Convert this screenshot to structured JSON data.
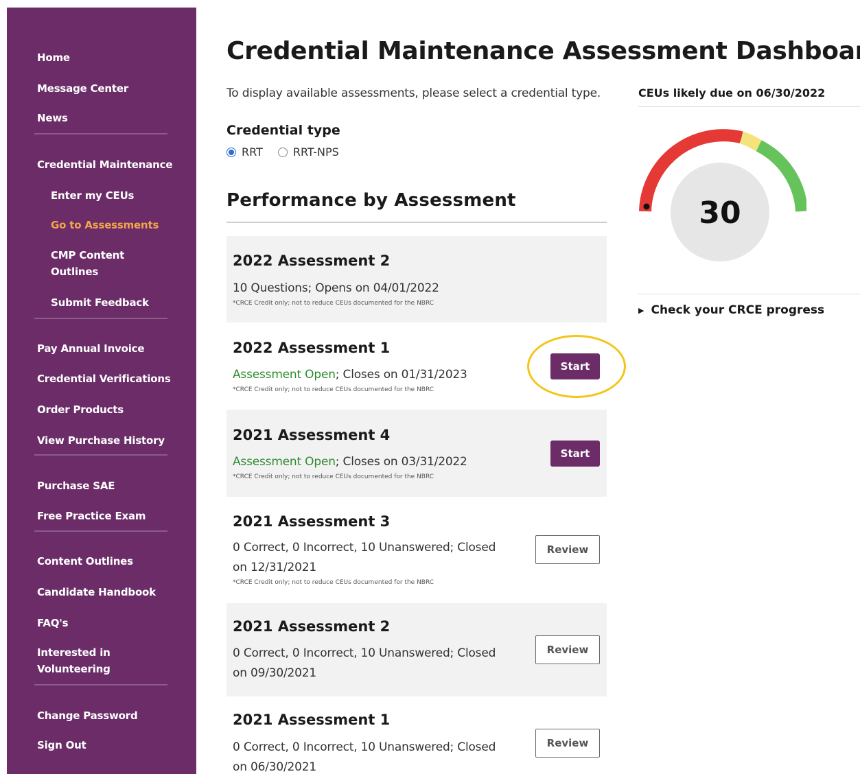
{
  "sidebar": {
    "items": [
      {
        "label": "Home"
      },
      {
        "label": "Message Center"
      },
      {
        "label": "News"
      },
      {
        "label": "Credential Maintenance"
      },
      {
        "label": "Enter my CEUs"
      },
      {
        "label": "Go to Assessments"
      },
      {
        "label": "CMP Content"
      },
      {
        "label": "Outlines"
      },
      {
        "label": "Submit Feedback"
      },
      {
        "label": "Pay Annual Invoice"
      },
      {
        "label": "Credential Verifications"
      },
      {
        "label": "Order Products"
      },
      {
        "label": "View Purchase History"
      },
      {
        "label": "Purchase SAE"
      },
      {
        "label": "Free Practice Exam"
      },
      {
        "label": "Content Outlines"
      },
      {
        "label": "Candidate Handbook"
      },
      {
        "label": "FAQ's"
      },
      {
        "label": "Interested in"
      },
      {
        "label": "Volunteering"
      },
      {
        "label": "Change Password"
      },
      {
        "label": "Sign Out"
      }
    ],
    "active_item": "Go to Assessments",
    "colors": {
      "background": "#6b2c68",
      "active": "#f2a54a"
    }
  },
  "main": {
    "title": "Credential Maintenance Assessment Dashboard",
    "instruction": "To display available assessments, please select a credential type.",
    "credential_type": {
      "label": "Credential type",
      "options": [
        "RRT",
        "RRT-NPS"
      ],
      "selected": "RRT"
    },
    "performance_heading": "Performance by Assessment",
    "assessments": [
      {
        "title": "2022 Assessment 2",
        "line1": "10 Questions; Opens on 04/01/2022",
        "note": "*CRCE Credit only; not to reduce CEUs documented for the NBRC"
      },
      {
        "title": "2022 Assessment 1",
        "status": "Assessment Open",
        "line1_rest": "; Closes on 01/31/2023",
        "note": "*CRCE Credit only; not to reduce CEUs documented for the NBRC",
        "button": "Start"
      },
      {
        "title": "2021 Assessment 4",
        "status": "Assessment Open",
        "line1_rest": "; Closes on 03/31/2022",
        "note": "*CRCE Credit only; not to reduce CEUs documented for the NBRC",
        "button": "Start"
      },
      {
        "title": "2021 Assessment 3",
        "line1": "0 Correct, 0 Incorrect, 10 Unanswered; Closed",
        "line2": "on 12/31/2021",
        "note": "*CRCE Credit only; not to reduce CEUs documented for the NBRC",
        "button": "Review"
      },
      {
        "title": "2021 Assessment 2",
        "line1": "0 Correct, 0 Incorrect, 10 Unanswered; Closed",
        "line2": "on 09/30/2021",
        "button": "Review"
      },
      {
        "title": "2021 Assessment 1",
        "line1": "0 Correct, 0 Incorrect, 10 Unanswered; Closed",
        "line2": "on 06/30/2021",
        "button": "Review"
      }
    ]
  },
  "right": {
    "ceu_label": "CEUs likely due on 06/30/2022",
    "gauge_value": "30",
    "gauge_colors": {
      "red": "#e53935",
      "yellow": "#f4e27a",
      "green": "#66c35c",
      "center": "#e6e6e6"
    },
    "crce_toggle": "Check your CRCE progress"
  }
}
